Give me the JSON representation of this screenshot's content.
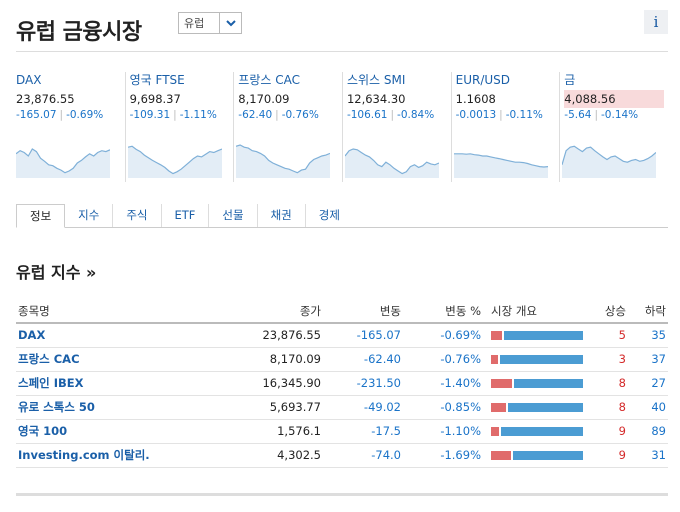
{
  "header": {
    "title": "유럽 금융시장",
    "region_select": "유럽",
    "info_label": "i"
  },
  "tiles": [
    {
      "name": "DAX",
      "price": "23,876.55",
      "change": "-165.07",
      "change_pct": "-0.69%",
      "highlight": false,
      "spark": [
        0.55,
        0.62,
        0.58,
        0.5,
        0.66,
        0.6,
        0.45,
        0.38,
        0.3,
        0.28,
        0.22,
        0.18,
        0.12,
        0.16,
        0.22,
        0.34,
        0.4,
        0.48,
        0.55,
        0.5,
        0.58,
        0.62,
        0.6,
        0.64
      ]
    },
    {
      "name": "영국 FTSE",
      "price": "9,698.37",
      "change": "-109.31",
      "change_pct": "-1.11%",
      "highlight": false,
      "spark": [
        0.7,
        0.72,
        0.65,
        0.6,
        0.52,
        0.46,
        0.4,
        0.35,
        0.3,
        0.24,
        0.16,
        0.1,
        0.14,
        0.2,
        0.28,
        0.36,
        0.44,
        0.5,
        0.48,
        0.54,
        0.6,
        0.58,
        0.62,
        0.66
      ]
    },
    {
      "name": "프랑스 CAC",
      "price": "8,170.09",
      "change": "-62.40",
      "change_pct": "-0.76%",
      "highlight": false,
      "spark": [
        0.72,
        0.75,
        0.7,
        0.68,
        0.62,
        0.6,
        0.56,
        0.5,
        0.4,
        0.34,
        0.3,
        0.26,
        0.22,
        0.2,
        0.16,
        0.12,
        0.18,
        0.2,
        0.34,
        0.42,
        0.46,
        0.5,
        0.52,
        0.56
      ]
    },
    {
      "name": "스위스 SMI",
      "price": "12,634.30",
      "change": "-106.61",
      "change_pct": "-0.84%",
      "highlight": false,
      "spark": [
        0.5,
        0.62,
        0.66,
        0.64,
        0.58,
        0.52,
        0.48,
        0.4,
        0.3,
        0.26,
        0.36,
        0.3,
        0.22,
        0.16,
        0.1,
        0.14,
        0.26,
        0.3,
        0.24,
        0.28,
        0.36,
        0.32,
        0.3,
        0.34
      ]
    },
    {
      "name": "EUR/USD",
      "price": "1.1608",
      "change": "-0.0013",
      "change_pct": "-0.11%",
      "highlight": false,
      "spark": [
        0.55,
        0.55,
        0.55,
        0.54,
        0.55,
        0.53,
        0.52,
        0.5,
        0.5,
        0.48,
        0.46,
        0.44,
        0.42,
        0.4,
        0.38,
        0.36,
        0.36,
        0.35,
        0.33,
        0.3,
        0.28,
        0.26,
        0.25,
        0.26
      ]
    },
    {
      "name": "금",
      "price": "4,088.56",
      "change": "-5.64",
      "change_pct": "-0.14%",
      "highlight": true,
      "spark": [
        0.3,
        0.62,
        0.7,
        0.72,
        0.66,
        0.6,
        0.68,
        0.7,
        0.62,
        0.55,
        0.48,
        0.42,
        0.48,
        0.5,
        0.44,
        0.38,
        0.36,
        0.4,
        0.42,
        0.38,
        0.4,
        0.44,
        0.5,
        0.58
      ]
    }
  ],
  "tabs": [
    "정보",
    "지수",
    "주식",
    "ETF",
    "선물",
    "채권",
    "경제"
  ],
  "section": {
    "title": "유럽 지수 »"
  },
  "table": {
    "headers": {
      "name": "종목명",
      "last": "종가",
      "change": "변동",
      "change_pct": "변동 %",
      "market": "시장 개요",
      "up": "상승",
      "down": "하락"
    },
    "rows": [
      {
        "name": "DAX",
        "last": "23,876.55",
        "change": "-165.07",
        "change_pct": "-0.69%",
        "up": "5",
        "down": "35"
      },
      {
        "name": "프랑스 CAC",
        "last": "8,170.09",
        "change": "-62.40",
        "change_pct": "-0.76%",
        "up": "3",
        "down": "37"
      },
      {
        "name": "스페인 IBEX",
        "last": "16,345.90",
        "change": "-231.50",
        "change_pct": "-1.40%",
        "up": "8",
        "down": "27"
      },
      {
        "name": "유로 스톡스 50",
        "last": "5,693.77",
        "change": "-49.02",
        "change_pct": "-0.85%",
        "up": "8",
        "down": "40"
      },
      {
        "name": "영국 100",
        "last": "1,576.1",
        "change": "-17.5",
        "change_pct": "-1.10%",
        "up": "9",
        "down": "89"
      },
      {
        "name": "Investing.com 이탈리.",
        "last": "4,302.5",
        "change": "-74.0",
        "change_pct": "-1.69%",
        "up": "9",
        "down": "31"
      }
    ]
  },
  "colors": {
    "link": "#1a5fa8",
    "negative": "#1a73c8",
    "up": "#d42a2a",
    "bar_up": "#e06b6b",
    "bar_down": "#4b9cd3",
    "spark_line": "#7fb0d8",
    "spark_fill": "#e3edf6"
  }
}
